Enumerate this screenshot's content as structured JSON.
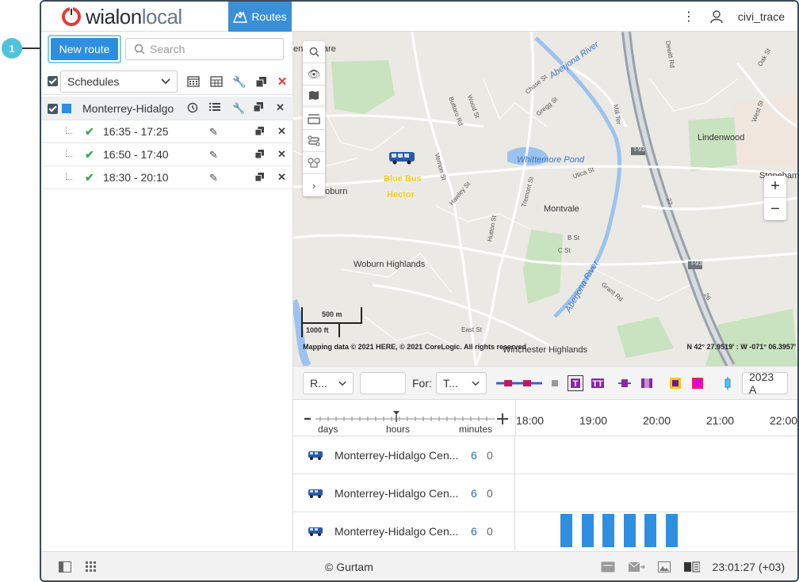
{
  "callout": {
    "number": "1"
  },
  "header": {
    "logo_brand": "wialon",
    "logo_suffix": "local",
    "active_tab": "Routes",
    "username": "civi_trace"
  },
  "left_panel": {
    "new_route_label": "New route",
    "search_placeholder": "Search",
    "filter_value": "Schedules",
    "group": {
      "name": "Monterrey-Hidalgo",
      "color": "#2e8ee0"
    },
    "schedules": [
      {
        "time": "16:35 - 17:25"
      },
      {
        "time": "16:50 - 17:40"
      },
      {
        "time": "18:30 - 20:10"
      }
    ]
  },
  "map": {
    "places": [
      "Lindenwood",
      "Montvale",
      "Woburn Highlands",
      "Winchester Highlands",
      "Stoneham",
      "Woburn"
    ],
    "water": [
      "Whittemore Pond",
      "Aberjona River",
      "Aberjona River"
    ],
    "streets": [
      "Chase St",
      "Gregg St",
      "Buttaro Rd",
      "Wood St",
      "Vernon St",
      "Hawley St",
      "Tremont St",
      "Hutton St",
      "B St",
      "C St",
      "Utica St",
      "West St",
      "Oak St",
      "Dewitt Rd",
      "Mill Ter",
      "Grant Rd",
      "East St"
    ],
    "highway_labels": [
      "I-93",
      "I-93",
      "27",
      "26"
    ],
    "square_label": "ent Square",
    "unit_label_1": "Blue Bus",
    "unit_label_2": "Hector",
    "scale_m": "500 m",
    "scale_ft": "1000 ft",
    "credit": "Mapping data © 2021 HERE, © 2021 CoreLogic. All rights reserved",
    "coords": "N 42° 27.9519' : W -071° 06.3957'"
  },
  "timeline": {
    "select1": "R...",
    "for_label": "For:",
    "select2": "T...",
    "date_value": "2023 A",
    "scale_labels": [
      "days",
      "hours",
      "minutes"
    ],
    "hours": [
      "18:00",
      "19:00",
      "20:00",
      "21:00",
      "22:00"
    ],
    "rows": [
      {
        "name": "Monterrey-Hidalgo Cen...",
        "n1": "6",
        "n2": "0"
      },
      {
        "name": "Monterrey-Hidalgo Cen...",
        "n1": "6",
        "n2": "0"
      },
      {
        "name": "Monterrey-Hidalgo Cen...",
        "n1": "6",
        "n2": "0"
      }
    ]
  },
  "footer": {
    "copyright": "© Gurtam",
    "clock": "23:01:27 (+03)"
  },
  "colors": {
    "accent": "#2e8ee0",
    "danger": "#e53935",
    "ok": "#3aa655"
  }
}
